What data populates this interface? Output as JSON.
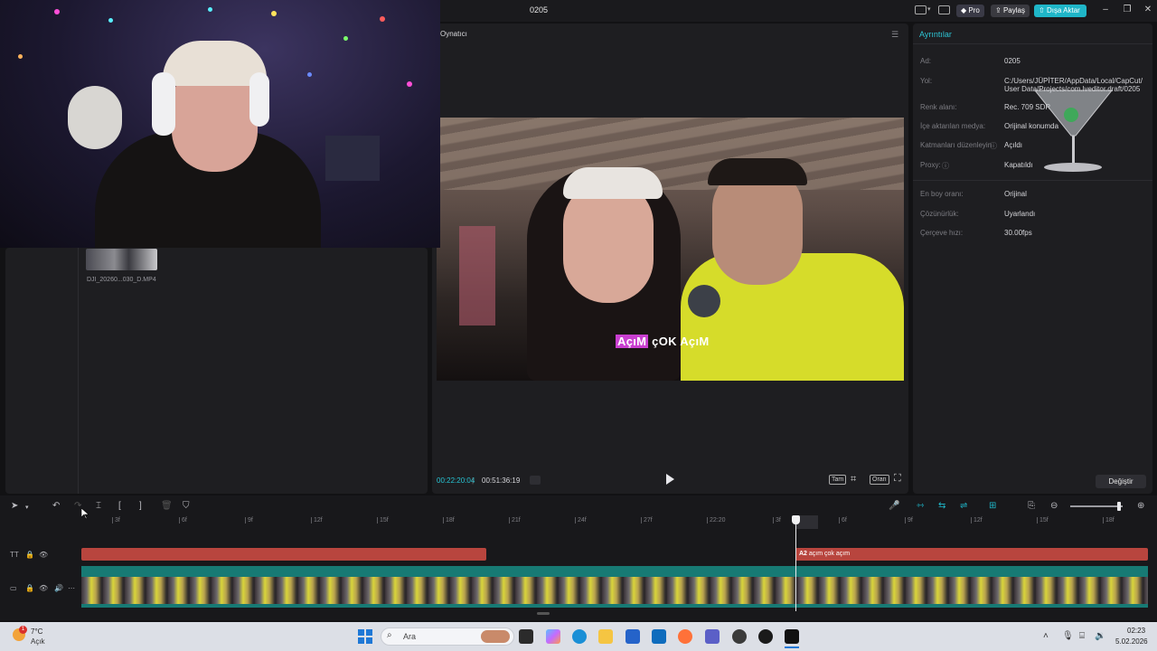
{
  "titlebar": {
    "project_name": "0205",
    "pro_label": "Pro",
    "share_label": "Paylaş",
    "export_label": "Dışa Aktar",
    "accent_color": "#1fb6c8"
  },
  "media": {
    "clip_name": "DJI_20260...030_D.MP4"
  },
  "player": {
    "title": "Oynatıcı",
    "subtitle_highlight": "AçıM",
    "subtitle_rest": " çOK AçıM",
    "current_time": "00:22:20:04",
    "total_time": "00:51:36:19",
    "btn_full": "Tam",
    "btn_ratio": "Oran"
  },
  "details": {
    "title": "Ayrıntılar",
    "rows": [
      {
        "label": "Ad:",
        "value": "0205"
      },
      {
        "label": "Yol:",
        "value": "C:/Users/JÜPİTER/AppData/Local/CapCut/"
      },
      {
        "label": "",
        "value": "User Data/Projects/com.lveditor.draft/0205"
      },
      {
        "label": "Renk alanı:",
        "value": "Rec. 709 SDR"
      },
      {
        "label": "İçe aktarılan medya:",
        "value": "Orijinal konumda"
      },
      {
        "label": "Katmanları düzenleyin",
        "value": "Açıldı"
      },
      {
        "label": "Proxy:",
        "value": "Kapatıldı"
      },
      {
        "label": "En boy oranı:",
        "value": "Orijinal"
      },
      {
        "label": "Çözünürlük:",
        "value": "Uyarlandı"
      },
      {
        "label": "Çerçeve hızı:",
        "value": "30.00fps"
      }
    ],
    "change_button": "Değiştir"
  },
  "timeline": {
    "ruler": [
      "3f",
      "6f",
      "9f",
      "12f",
      "15f",
      "18f",
      "21f",
      "24f",
      "27f",
      "22:20",
      "3f",
      "6f",
      "9f",
      "12f",
      "15f",
      "18f"
    ],
    "text_clip_label": "açım çok açım",
    "text_clip_badge": "A2"
  },
  "taskbar": {
    "weather_temp": "7°C",
    "weather_desc": "Açık",
    "search_placeholder": "Ara",
    "time": "02:23",
    "date": "5.02.2026",
    "notification_count": "1"
  }
}
